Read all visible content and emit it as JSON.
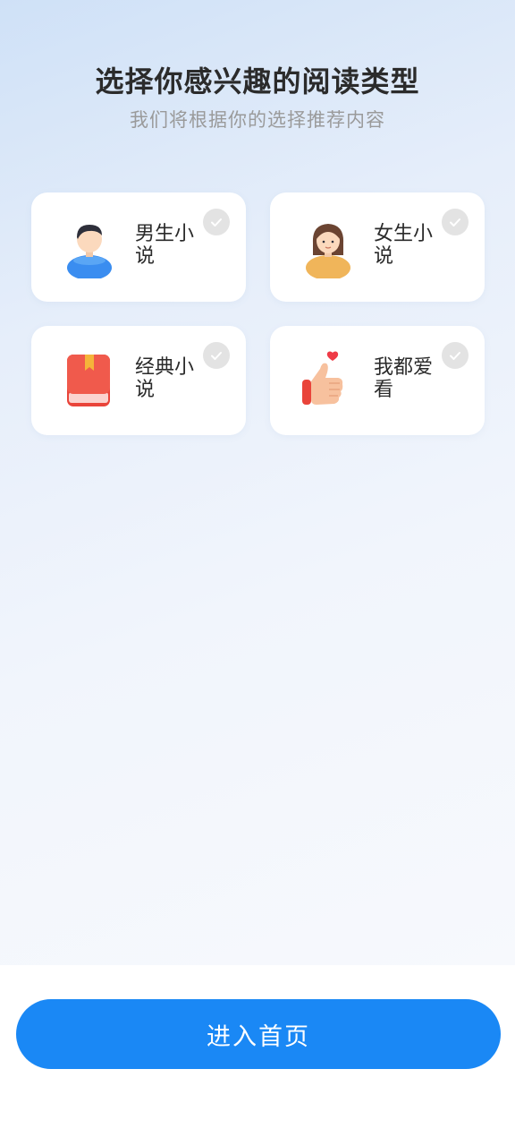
{
  "header": {
    "title": "选择你感兴趣的阅读类型",
    "subtitle": "我们将根据你的选择推荐内容"
  },
  "cards": [
    {
      "label": "男生小说",
      "icon": "boy-avatar-icon",
      "selected": false
    },
    {
      "label": "女生小说",
      "icon": "girl-avatar-icon",
      "selected": false
    },
    {
      "label": "经典小说",
      "icon": "red-book-icon",
      "selected": false
    },
    {
      "label": "我都爱看",
      "icon": "thumbs-up-heart-icon",
      "selected": false
    }
  ],
  "footer": {
    "enter_label": "进入首页"
  },
  "colors": {
    "accent": "#1a88f5",
    "check_unselected": "#e3e3e3"
  }
}
